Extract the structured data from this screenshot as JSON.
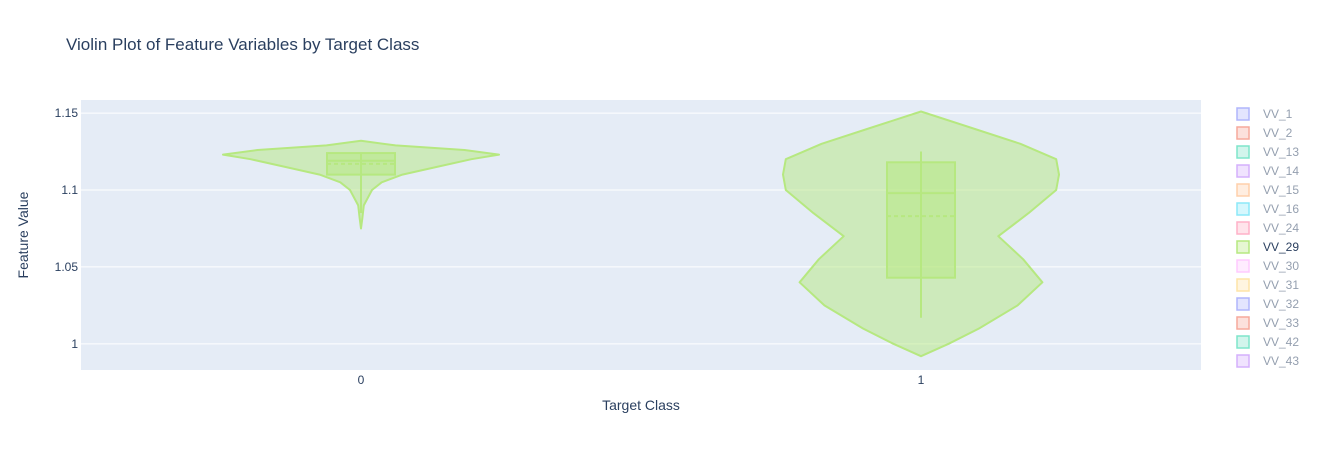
{
  "chart_data": {
    "type": "violin",
    "title": "Violin Plot of Feature Variables by Target Class",
    "xlabel": "Target Class",
    "ylabel": "Feature Value",
    "categories": [
      "0",
      "1"
    ],
    "ylim": [
      0.983,
      1.1585
    ],
    "yticks": [
      1,
      1.05,
      1.1,
      1.15
    ],
    "ytick_labels": [
      "1",
      "1.05",
      "1.1",
      "1.15"
    ],
    "grid": true,
    "legend_position": "right",
    "visible_series": "VV_29",
    "plot_bg": "#e5ecf6",
    "series": [
      {
        "name": "VV_1",
        "color": "#636efa"
      },
      {
        "name": "VV_2",
        "color": "#EF553B"
      },
      {
        "name": "VV_13",
        "color": "#00cc96"
      },
      {
        "name": "VV_14",
        "color": "#ab63fa"
      },
      {
        "name": "VV_15",
        "color": "#FFA15A"
      },
      {
        "name": "VV_16",
        "color": "#19d3f3"
      },
      {
        "name": "VV_24",
        "color": "#FF6692"
      },
      {
        "name": "VV_29",
        "color": "#B6E880"
      },
      {
        "name": "VV_30",
        "color": "#FF97FF"
      },
      {
        "name": "VV_31",
        "color": "#FECB52"
      },
      {
        "name": "VV_32",
        "color": "#636efa"
      },
      {
        "name": "VV_33",
        "color": "#EF553B"
      },
      {
        "name": "VV_42",
        "color": "#00cc96"
      },
      {
        "name": "VV_43",
        "color": "#ab63fa"
      }
    ],
    "violins": [
      {
        "category": "0",
        "min": 1.075,
        "max": 1.132,
        "q1": 1.11,
        "median": 1.119,
        "q3": 1.124,
        "mean": 1.117,
        "whisker_low": 1.085,
        "whisker_high": 1.124,
        "density": [
          [
            1.075,
            0.0
          ],
          [
            1.082,
            0.01
          ],
          [
            1.09,
            0.02
          ],
          [
            1.1,
            0.08
          ],
          [
            1.105,
            0.15
          ],
          [
            1.11,
            0.3
          ],
          [
            1.115,
            0.55
          ],
          [
            1.12,
            0.8
          ],
          [
            1.123,
            1.0
          ],
          [
            1.126,
            0.75
          ],
          [
            1.129,
            0.25
          ],
          [
            1.132,
            0.0
          ]
        ]
      },
      {
        "category": "1",
        "min": 0.992,
        "max": 1.151,
        "q1": 1.043,
        "median": 1.098,
        "q3": 1.118,
        "mean": 1.083,
        "whisker_low": 1.017,
        "whisker_high": 1.125,
        "density": [
          [
            0.992,
            0.0
          ],
          [
            1.0,
            0.2
          ],
          [
            1.01,
            0.42
          ],
          [
            1.025,
            0.7
          ],
          [
            1.04,
            0.88
          ],
          [
            1.055,
            0.74
          ],
          [
            1.07,
            0.56
          ],
          [
            1.085,
            0.78
          ],
          [
            1.1,
            0.98
          ],
          [
            1.11,
            1.0
          ],
          [
            1.12,
            0.98
          ],
          [
            1.13,
            0.72
          ],
          [
            1.14,
            0.38
          ],
          [
            1.151,
            0.0
          ]
        ]
      }
    ]
  }
}
